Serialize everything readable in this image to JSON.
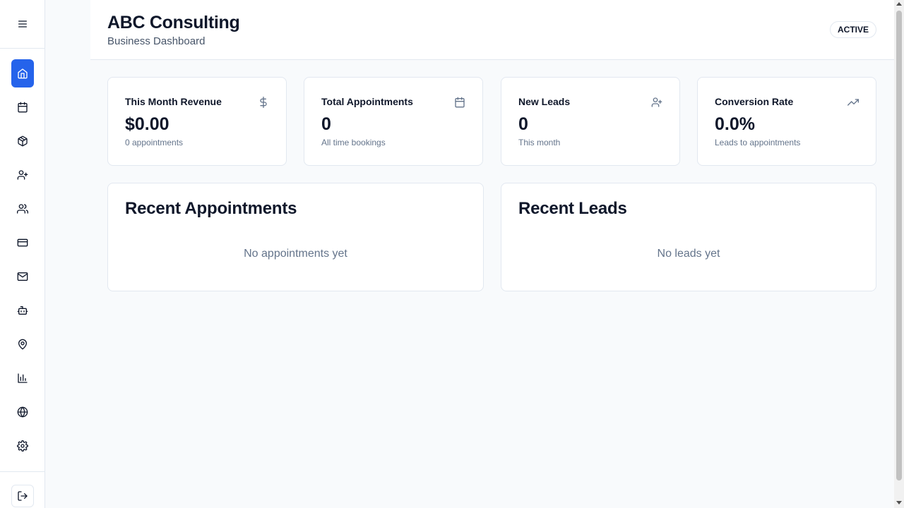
{
  "header": {
    "title": "ABC Consulting",
    "subtitle": "Business Dashboard",
    "status": "ACTIVE"
  },
  "sidebar": {
    "menu_icon": "menu-icon",
    "items": [
      {
        "icon": "home-icon",
        "active": true
      },
      {
        "icon": "calendar-icon",
        "active": false
      },
      {
        "icon": "package-icon",
        "active": false
      },
      {
        "icon": "user-plus-icon",
        "active": false
      },
      {
        "icon": "users-icon",
        "active": false
      },
      {
        "icon": "credit-card-icon",
        "active": false
      },
      {
        "icon": "mail-icon",
        "active": false
      },
      {
        "icon": "bot-icon",
        "active": false
      },
      {
        "icon": "map-pin-icon",
        "active": false
      },
      {
        "icon": "bar-chart-icon",
        "active": false
      },
      {
        "icon": "globe-icon",
        "active": false
      },
      {
        "icon": "settings-icon",
        "active": false
      }
    ],
    "logout_icon": "log-out-icon"
  },
  "stats": [
    {
      "title": "This Month Revenue",
      "value": "$0.00",
      "sub": "0 appointments",
      "icon": "dollar-sign-icon"
    },
    {
      "title": "Total Appointments",
      "value": "0",
      "sub": "All time bookings",
      "icon": "calendar-icon"
    },
    {
      "title": "New Leads",
      "value": "0",
      "sub": "This month",
      "icon": "user-plus-icon"
    },
    {
      "title": "Conversion Rate",
      "value": "0.0%",
      "sub": "Leads to appointments",
      "icon": "trending-up-icon"
    }
  ],
  "panels": {
    "appointments": {
      "title": "Recent Appointments",
      "empty": "No appointments yet"
    },
    "leads": {
      "title": "Recent Leads",
      "empty": "No leads yet"
    }
  },
  "colors": {
    "accent": "#2563eb",
    "background": "#f8fafc",
    "border": "#e2e8f0",
    "muted_text": "#64748b"
  }
}
